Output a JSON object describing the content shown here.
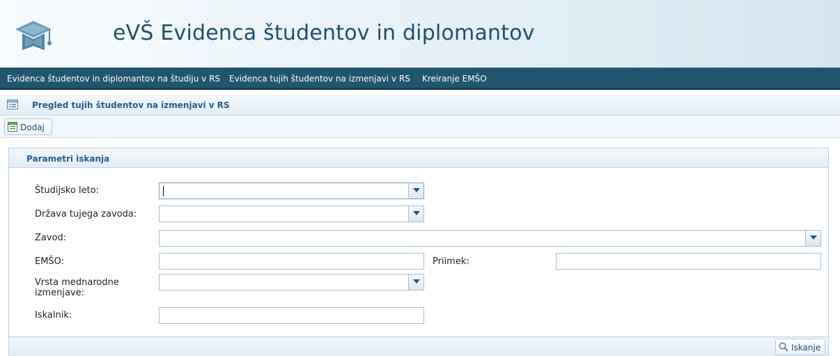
{
  "app": {
    "title": "eVŠ Evidenca študentov in diplomantov"
  },
  "nav": {
    "items": [
      {
        "label": "Evidenca študentov in diplomantov na študiju v RS"
      },
      {
        "label": "Evidenca tujih študentov na izmenjavi v RS"
      },
      {
        "label": "Kreiranje EMŠO"
      }
    ]
  },
  "page": {
    "title": "Pregled tujih študentov na izmenjavi v RS"
  },
  "toolbar": {
    "add_label": "Dodaj"
  },
  "search_panel": {
    "title": "Parametri iskanja",
    "fields": {
      "study_year": {
        "label": "Študijsko leto:",
        "value": ""
      },
      "foreign_country": {
        "label": "Država tujega zavoda:",
        "value": ""
      },
      "institution": {
        "label": "Zavod:",
        "value": ""
      },
      "emso": {
        "label": "EMŠO:",
        "value": ""
      },
      "surname": {
        "label": "Priimek:",
        "value": ""
      },
      "exchange_type": {
        "label": "Vrsta mednarodne izmenjave:",
        "value": ""
      },
      "search_term": {
        "label": "Iskalnik:",
        "value": ""
      }
    },
    "search_button_label": "Iskanje"
  },
  "colors": {
    "nav_background": "#22566e",
    "title_text": "#1f4f72",
    "section_title": "#2a5c8a"
  }
}
